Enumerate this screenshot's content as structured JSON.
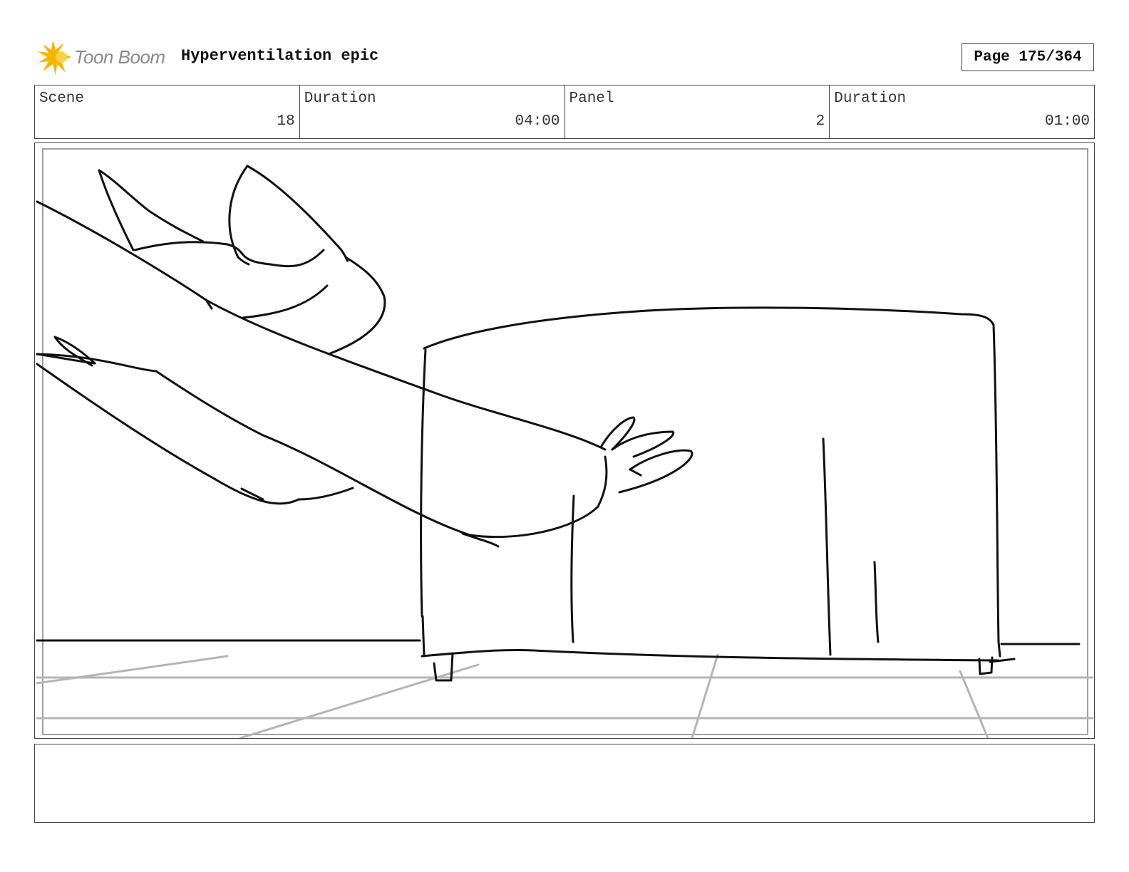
{
  "header": {
    "logo_text": "Toon Boom",
    "project_title": "Hyperventilation epic",
    "page_indicator": "Page 175/364"
  },
  "info": {
    "scene_label": "Scene",
    "scene_value": "18",
    "scene_duration_label": "Duration",
    "scene_duration_value": "04:00",
    "panel_label": "Panel",
    "panel_value": "2",
    "panel_duration_label": "Duration",
    "panel_duration_value": "01:00"
  },
  "notes": {
    "text": ""
  },
  "colors": {
    "logo_orange": "#f7b500",
    "logo_gray": "#8a8a8a",
    "sketch_black": "#111111",
    "sketch_gray": "#b5b5b5",
    "safe_area_gray": "#a0a0a0"
  }
}
